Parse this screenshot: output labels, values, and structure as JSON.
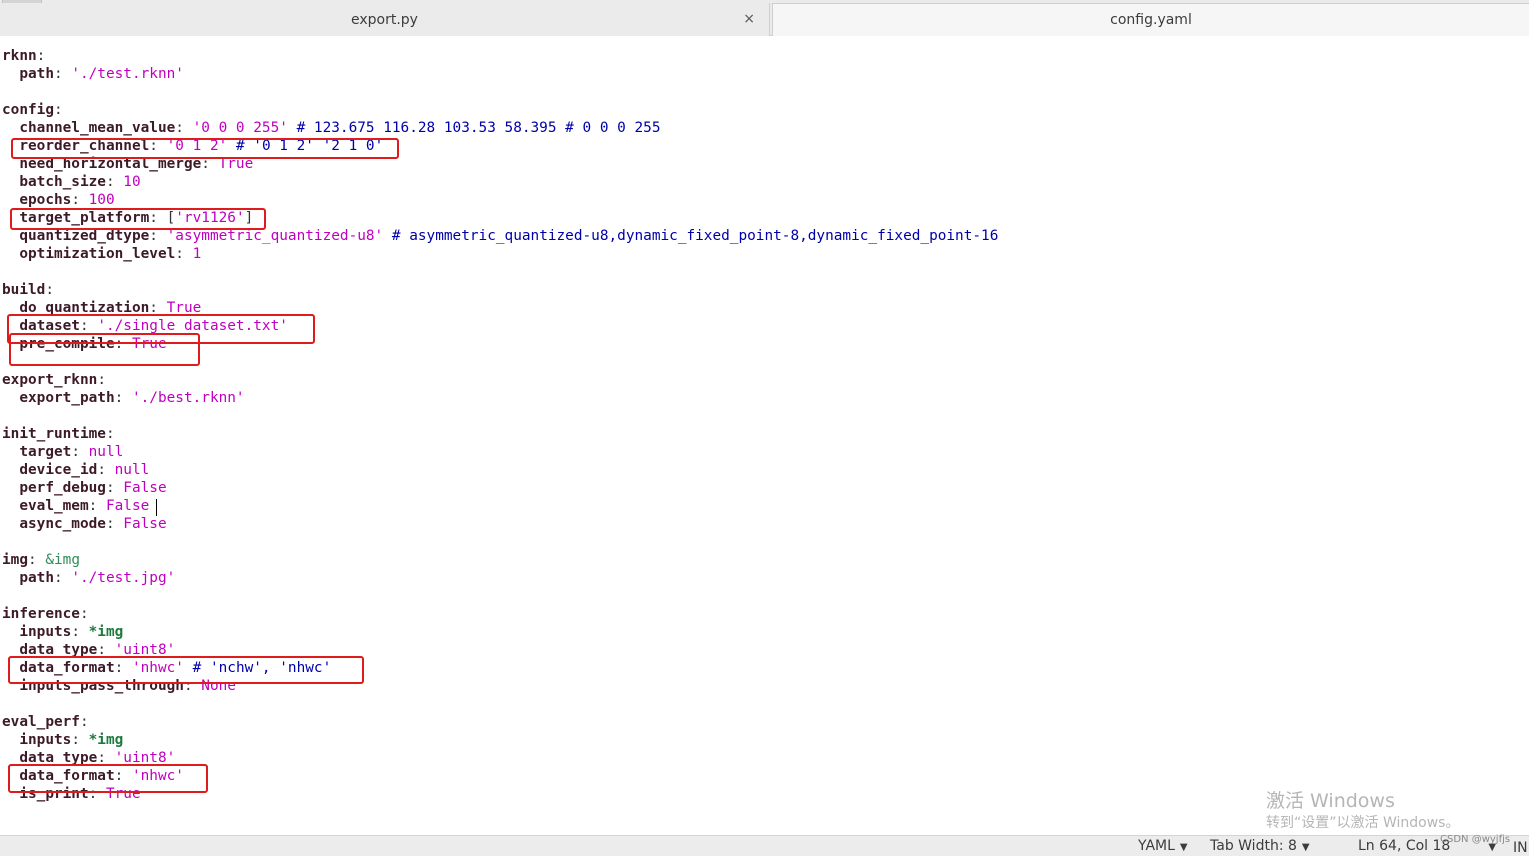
{
  "tabs": [
    {
      "label": "export.py",
      "close": "×"
    },
    {
      "label": "config.yaml"
    }
  ],
  "code": {
    "l1_key": "rknn",
    "l2_key": "path",
    "l2_val": "'./test.rknn'",
    "l4_key": "config",
    "l5_key": "channel_mean_value",
    "l5_val": "'0 0 0 255'",
    "l5_com": "# 123.675 116.28 103.53 58.395 # 0 0 0 255",
    "l6_key": "reorder_channel",
    "l6_val": "'0 1 2'",
    "l6_com": "# '0 1 2' '2 1 0'",
    "l7_key": "need_horizontal_merge",
    "l7_val": "True",
    "l8_key": "batch_size",
    "l8_val": "10",
    "l9_key": "epochs",
    "l9_val": "100",
    "l10_key": "target_platform",
    "l10_val": "'rv1126'",
    "l11_key": "quantized_dtype",
    "l11_val": "'asymmetric_quantized-u8'",
    "l11_com": "# asymmetric_quantized-u8,dynamic_fixed_point-8,dynamic_fixed_point-16",
    "l12_key": "optimization_level",
    "l12_val": "1",
    "l14_key": "build",
    "l15_key": "do_quantization",
    "l15_val": "True",
    "l16_key": "dataset",
    "l16_val": "'./single_dataset.txt'",
    "l17_key": "pre_compile",
    "l17_val": "True",
    "l19_key": "export_rknn",
    "l20_key": "export_path",
    "l20_val": "'./best.rknn'",
    "l22_key": "init_runtime",
    "l23_key": "target",
    "l23_val": "null",
    "l24_key": "device_id",
    "l24_val": "null",
    "l25_key": "perf_debug",
    "l25_val": "False",
    "l26_key": "eval_mem",
    "l26_val": "False",
    "l27_key": "async_mode",
    "l27_val": "False",
    "l29_key": "img",
    "l29_anchor": "&img",
    "l30_key": "path",
    "l30_val": "'./test.jpg'",
    "l32_key": "inference",
    "l33_key": "inputs",
    "l33_alias": "*img",
    "l34_key": "data_type",
    "l34_val": "'uint8'",
    "l35_key": "data_format",
    "l35_val": "'nhwc'",
    "l35_com": "# 'nchw', 'nhwc'",
    "l36_key": "inputs_pass_through",
    "l36_val": "None",
    "l38_key": "eval_perf",
    "l39_key": "inputs",
    "l39_alias": "*img",
    "l40_key": "data_type",
    "l40_val": "'uint8'",
    "l41_key": "data_format",
    "l41_val": "'nhwc'",
    "l42_key": "is_print",
    "l42_val": "True"
  },
  "statusbar": {
    "language": "YAML",
    "tab_width": "Tab Width: 8",
    "position": "Ln 64, Col 18",
    "mode": "IN"
  },
  "watermark": {
    "line1": "激活 Windows",
    "line2": "转到“设置”以激活 Windows。",
    "csdn": "CSDN @wyjfjs"
  },
  "colors": {
    "highlight_box": "#e01b1b",
    "string": "#c000c0",
    "comment": "#0000a8"
  }
}
